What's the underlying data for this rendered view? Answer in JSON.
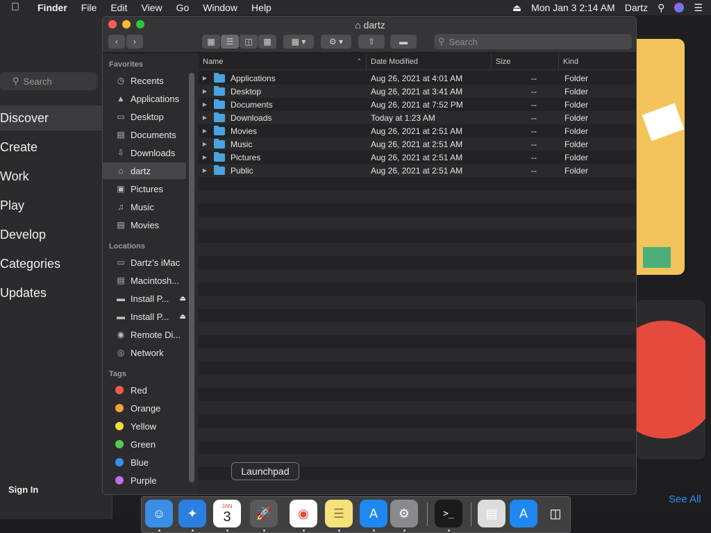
{
  "menubar": {
    "app": "Finder",
    "items": [
      "File",
      "Edit",
      "View",
      "Go",
      "Window",
      "Help"
    ],
    "datetime": "Mon Jan 3  2:14 AM",
    "user": "Dartz"
  },
  "appstore": {
    "search_placeholder": "Search",
    "nav": [
      "Discover",
      "Create",
      "Work",
      "Play",
      "Develop",
      "Categories",
      "Updates"
    ],
    "selected_nav": "Discover",
    "sign_in": "Sign In",
    "see_all": "See All"
  },
  "finder": {
    "title": "dartz",
    "search_placeholder": "Search",
    "sidebar": {
      "favorites_header": "Favorites",
      "favorites": [
        {
          "label": "Recents",
          "icon": "clock-icon"
        },
        {
          "label": "Applications",
          "icon": "applications-icon"
        },
        {
          "label": "Desktop",
          "icon": "desktop-icon"
        },
        {
          "label": "Documents",
          "icon": "document-icon"
        },
        {
          "label": "Downloads",
          "icon": "download-icon"
        },
        {
          "label": "dartz",
          "icon": "home-icon"
        },
        {
          "label": "Pictures",
          "icon": "pictures-icon"
        },
        {
          "label": "Music",
          "icon": "music-icon"
        },
        {
          "label": "Movies",
          "icon": "movies-icon"
        }
      ],
      "locations_header": "Locations",
      "locations": [
        {
          "label": "Dartz’s iMac",
          "icon": "imac-icon"
        },
        {
          "label": "Macintosh...",
          "icon": "disk-icon"
        },
        {
          "label": "Install P...",
          "icon": "drive-icon"
        },
        {
          "label": "Install P...",
          "icon": "drive-icon"
        },
        {
          "label": "Remote Di...",
          "icon": "remote-disc-icon"
        },
        {
          "label": "Network",
          "icon": "network-icon"
        }
      ],
      "tags_header": "Tags",
      "tags": [
        {
          "label": "Red",
          "color": "#f05a4f"
        },
        {
          "label": "Orange",
          "color": "#f3a33a"
        },
        {
          "label": "Yellow",
          "color": "#f4dc3c"
        },
        {
          "label": "Green",
          "color": "#5ac94f"
        },
        {
          "label": "Blue",
          "color": "#3b8ef0"
        },
        {
          "label": "Purple",
          "color": "#c46ce0"
        }
      ]
    },
    "columns": [
      "Name",
      "Date Modified",
      "Size",
      "Kind"
    ],
    "files": [
      {
        "name": "Applications",
        "date": "Aug 26, 2021 at 4:01 AM",
        "size": "--",
        "kind": "Folder"
      },
      {
        "name": "Desktop",
        "date": "Aug 26, 2021 at 3:41 AM",
        "size": "--",
        "kind": "Folder"
      },
      {
        "name": "Documents",
        "date": "Aug 26, 2021 at 7:52 PM",
        "size": "--",
        "kind": "Folder"
      },
      {
        "name": "Downloads",
        "date": "Today at 1:23 AM",
        "size": "--",
        "kind": "Folder"
      },
      {
        "name": "Movies",
        "date": "Aug 26, 2021 at 2:51 AM",
        "size": "--",
        "kind": "Folder"
      },
      {
        "name": "Music",
        "date": "Aug 26, 2021 at 2:51 AM",
        "size": "--",
        "kind": "Folder"
      },
      {
        "name": "Pictures",
        "date": "Aug 26, 2021 at 2:51 AM",
        "size": "--",
        "kind": "Folder"
      },
      {
        "name": "Public",
        "date": "Aug 26, 2021 at 2:51 AM",
        "size": "--",
        "kind": "Folder"
      }
    ]
  },
  "dock": {
    "tooltip": "Launchpad",
    "calendar_month": "JAN",
    "calendar_day": "3",
    "apps": [
      {
        "name": "finder-icon",
        "color": "#3a8ee6"
      },
      {
        "name": "safari-icon",
        "color": "#2a7fe0"
      },
      {
        "name": "calendar-icon",
        "color": "#ffffff"
      },
      {
        "name": "launchpad-icon",
        "color": "#5a5a5e"
      },
      {
        "name": "chrome-icon",
        "color": "#ffffff"
      },
      {
        "name": "notes-icon",
        "color": "#f6e27a"
      },
      {
        "name": "app-store-icon",
        "color": "#1e88f0"
      },
      {
        "name": "system-preferences-icon",
        "color": "#8a8a8e"
      },
      {
        "name": "terminal-icon",
        "color": "#1a1a1a"
      },
      {
        "name": "installer-icon",
        "color": "#dcdcdc"
      },
      {
        "name": "app-store-installer-icon",
        "color": "#1e88f0"
      },
      {
        "name": "trash-icon",
        "color": "#7a7a7e"
      }
    ]
  }
}
